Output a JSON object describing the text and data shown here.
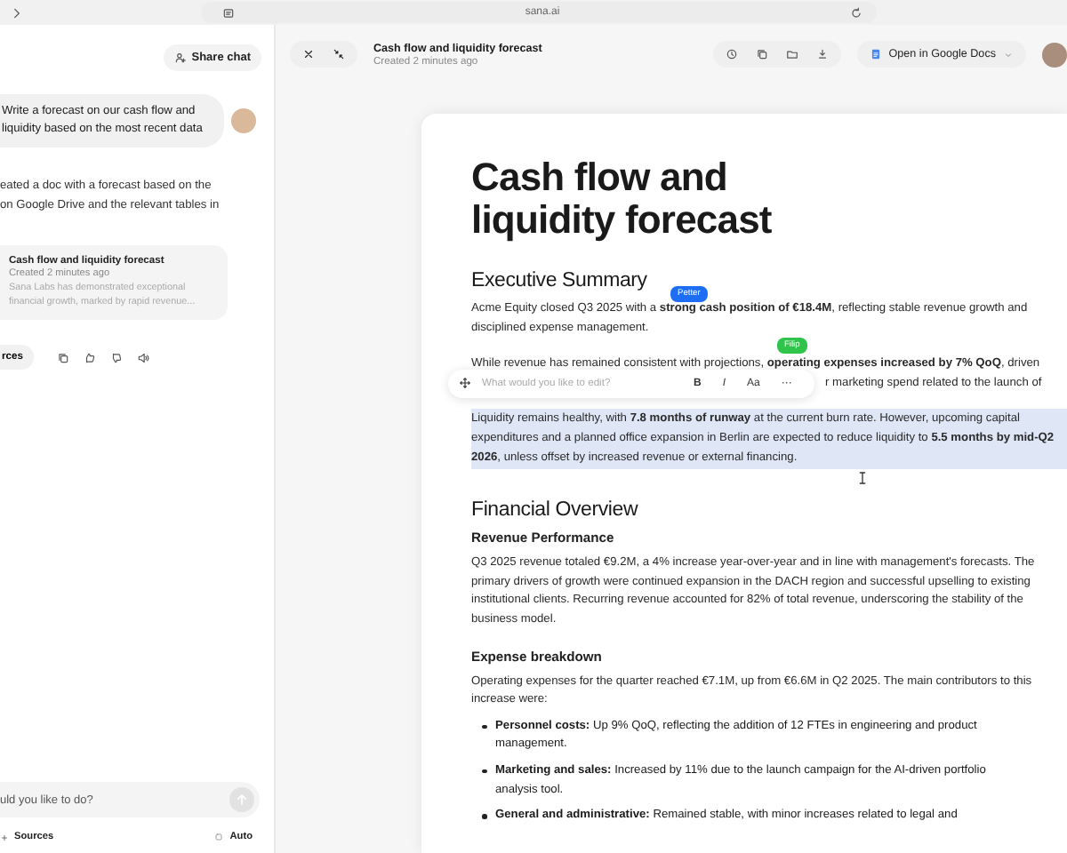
{
  "browser": {
    "address": "sana.ai"
  },
  "chat": {
    "share_label": "Share chat",
    "user_message": "Write a forecast on our cash flow and liquidity based on the most recent data",
    "assistant_lines": [
      "eated a doc with a forecast based on the",
      "on Google Drive and the relevant tables in"
    ],
    "doc_card": {
      "title": "Cash flow and liquidity forecast",
      "created": "Created 2 minutes ago",
      "snippet": "Sana Labs has demonstrated exceptional financial growth, marked by rapid revenue..."
    },
    "sources_button": "rces",
    "input": {
      "placeholder": "uld you like to do?"
    },
    "footer": {
      "sources": "Sources",
      "mode": "Auto"
    }
  },
  "doc_panel": {
    "title": "Cash flow and liquidity forecast",
    "created": "Created 2 minutes ago",
    "open_button": "Open in Google Docs"
  },
  "document": {
    "title": "Cash flow and liquidity forecast",
    "blocks": [
      {
        "kind": "h2",
        "text": "Executive Summary"
      },
      {
        "kind": "p",
        "text": "Acme Equity closed Q3 2025 with a **strong cash position of €18.4M**, reflecting stable revenue growth and disciplined expense management.",
        "cursor": {
          "name": "Petter",
          "color": "#1d6ef5"
        }
      },
      {
        "kind": "line",
        "text": "While revenue has remained consistent with projections, **operating expenses increased by 7% QoQ**, driven",
        "cursor": {
          "name": "Filip",
          "color": "#2fc44a"
        }
      },
      {
        "kind": "fragment",
        "text": "r marketing spend related to the launch of"
      },
      {
        "kind": "highlight",
        "text": "Liquidity remains healthy, with **7.8 months of runway** at the current burn rate. However, upcoming capital expenditures and a planned office expansion in Berlin are expected to reduce liquidity to **5.5 months by mid-Q2 2026**, unless offset by increased revenue or external financing."
      },
      {
        "kind": "h2",
        "text": "Financial Overview"
      },
      {
        "kind": "h3",
        "text": "Revenue Performance"
      },
      {
        "kind": "p",
        "text": "Q3 2025 revenue totaled €9.2M, a 4% increase year-over-year and in line with management's forecasts. The primary drivers of growth were continued expansion in the DACH region and successful upselling to existing institutional clients. Recurring revenue accounted for 82% of total revenue, underscoring the stability of the business model."
      },
      {
        "kind": "h3",
        "text": "Expense breakdown"
      },
      {
        "kind": "p",
        "text": "Operating expenses for the quarter reached €7.1M, up from €6.6M in Q2 2025. The main contributors to this increase were:"
      },
      {
        "kind": "bullet",
        "text": "**Personnel costs:** Up 9% QoQ, reflecting the addition of 12 FTEs in engineering and product management."
      },
      {
        "kind": "bullet",
        "text": "**Marketing and sales:** Increased by 11% due to the launch campaign for the AI-driven portfolio analysis tool."
      },
      {
        "kind": "bullet",
        "text": "**General and administrative:** Remained stable, with minor increases related to legal and"
      }
    ]
  },
  "edit_popup": {
    "placeholder": "What would you like to edit?",
    "buttons": [
      "B",
      "I",
      "Aa",
      "···"
    ]
  }
}
